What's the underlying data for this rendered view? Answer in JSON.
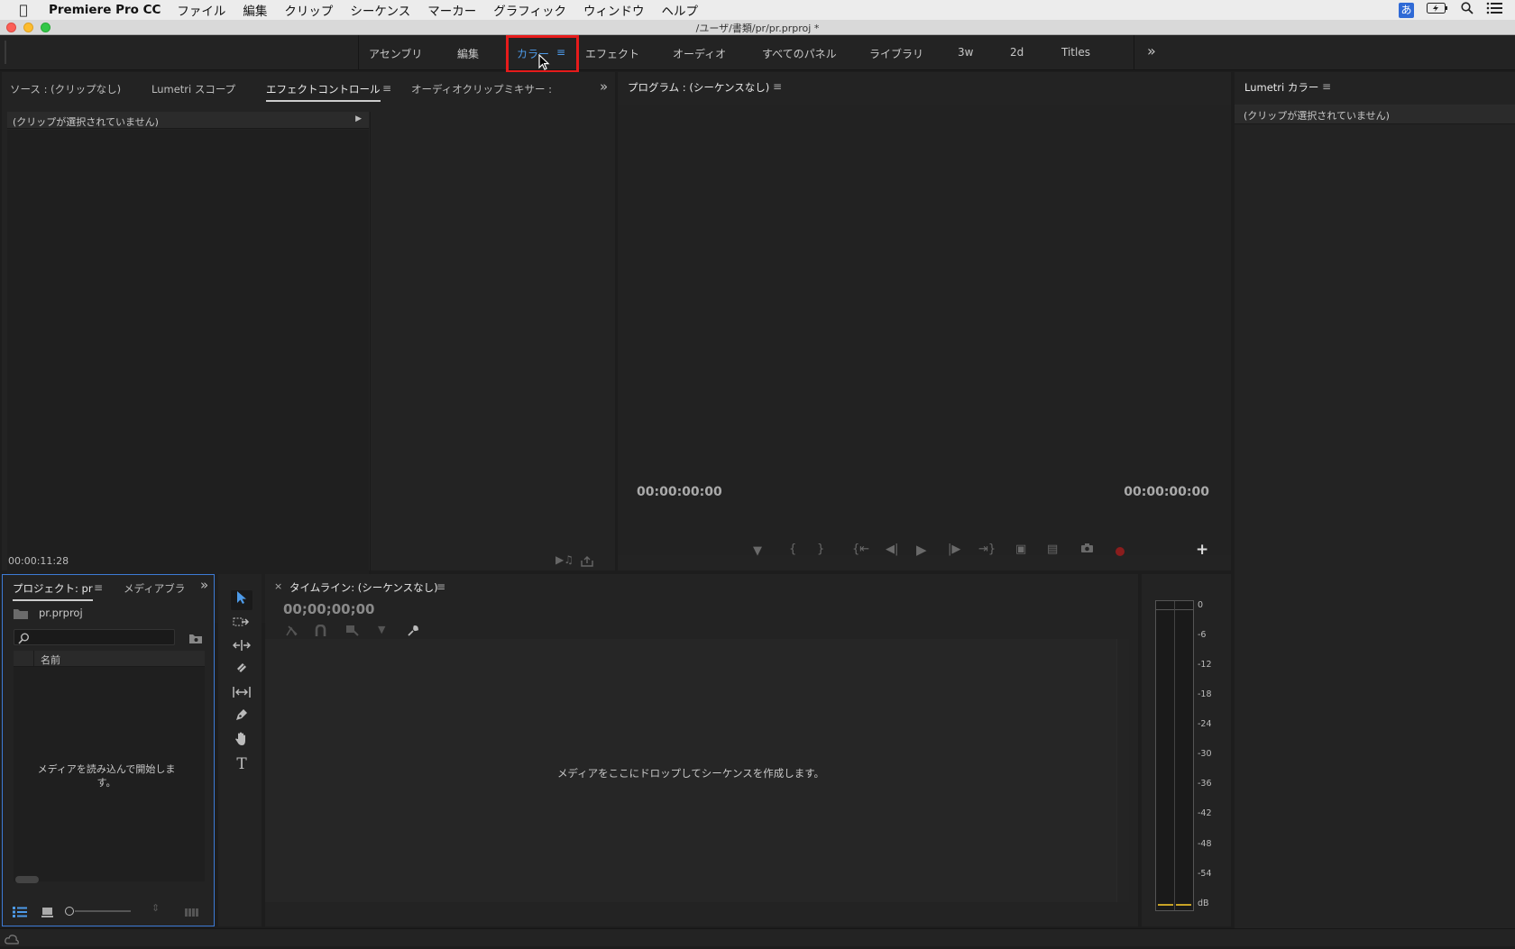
{
  "menubar": {
    "app_name": "Premiere Pro CC",
    "menus": [
      "ファイル",
      "編集",
      "クリップ",
      "シーケンス",
      "マーカー",
      "グラフィック",
      "ウィンドウ",
      "ヘルプ"
    ],
    "ime": "あ"
  },
  "window": {
    "title": "/ユーザ/書類/pr/pr.prproj *"
  },
  "workspaces": {
    "tabs": [
      "アセンブリ",
      "編集",
      "カラー",
      "エフェクト",
      "オーディオ",
      "すべてのパネル",
      "ライブラリ",
      "3w",
      "2d",
      "Titles"
    ],
    "active": "カラー",
    "overflow": "»"
  },
  "source_panel": {
    "tabs": [
      "ソース : (クリップなし)",
      "Lumetri スコープ",
      "エフェクトコントロール",
      "オーディオクリップミキサー :"
    ],
    "active_tab": "エフェクトコントロール",
    "no_clip": "(クリップが選択されていません)",
    "timecode": "00:00:11:28",
    "overflow": "»"
  },
  "program_panel": {
    "title": "プログラム : (シーケンスなし)",
    "timecode_left": "00:00:00:00",
    "timecode_right": "00:00:00:00",
    "add_button": "+"
  },
  "lumetri_panel": {
    "title": "Lumetri カラー",
    "no_clip": "(クリップが選択されていません)"
  },
  "project_panel": {
    "tabs": [
      "プロジェクト: pr",
      "メディアブラ"
    ],
    "file": "pr.prproj",
    "column_name": "名前",
    "empty_message": "メディアを読み込んで開始します。",
    "overflow": "»"
  },
  "timeline_panel": {
    "title": "タイムライン: (シーケンスなし)",
    "close": "×",
    "timecode": "00;00;00;00",
    "drop_message": "メディアをここにドロップしてシーケンスを作成します。"
  },
  "audio_meter": {
    "ticks": [
      "0",
      "-6",
      "-12",
      "-18",
      "-24",
      "-30",
      "-36",
      "-42",
      "-48",
      "-54",
      "dB"
    ]
  },
  "colors": {
    "accent": "#4d9ae8",
    "highlight": "#e61b1b"
  }
}
